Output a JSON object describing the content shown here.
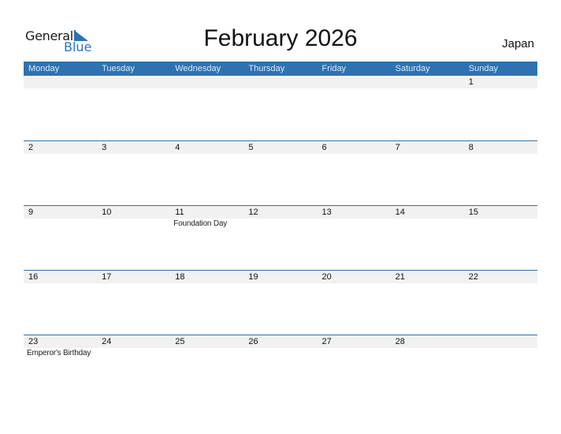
{
  "brand": {
    "word1": "General",
    "word2": "Blue",
    "icon": "blue-triangle-icon",
    "color": "#2a74b8"
  },
  "title": "February 2026",
  "country": "Japan",
  "colors": {
    "header_bg": "#2e72b0",
    "day_strip_bg": "#f1f1f1",
    "border": "#2e72b0"
  },
  "weekdays": [
    "Monday",
    "Tuesday",
    "Wednesday",
    "Thursday",
    "Friday",
    "Saturday",
    "Sunday"
  ],
  "weeks": [
    {
      "days": [
        "",
        "",
        "",
        "",
        "",
        "",
        "1"
      ],
      "events": [
        "",
        "",
        "",
        "",
        "",
        "",
        ""
      ]
    },
    {
      "days": [
        "2",
        "3",
        "4",
        "5",
        "6",
        "7",
        "8"
      ],
      "events": [
        "",
        "",
        "",
        "",
        "",
        "",
        ""
      ]
    },
    {
      "days": [
        "9",
        "10",
        "11",
        "12",
        "13",
        "14",
        "15"
      ],
      "events": [
        "",
        "",
        "Foundation Day",
        "",
        "",
        "",
        ""
      ]
    },
    {
      "days": [
        "16",
        "17",
        "18",
        "19",
        "20",
        "21",
        "22"
      ],
      "events": [
        "",
        "",
        "",
        "",
        "",
        "",
        ""
      ]
    },
    {
      "days": [
        "23",
        "24",
        "25",
        "26",
        "27",
        "28",
        ""
      ],
      "events": [
        "Emperor's Birthday",
        "",
        "",
        "",
        "",
        "",
        ""
      ]
    }
  ]
}
